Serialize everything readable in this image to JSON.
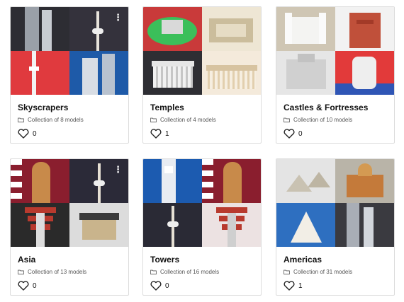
{
  "collections": [
    {
      "title": "Skyscrapers",
      "subtitle": "Collection of 8 models",
      "likes": "0",
      "colors": [
        "#2b2b30",
        "#3a3a45",
        "#e03a3e",
        "#1e5aa8"
      ]
    },
    {
      "title": "Temples",
      "subtitle": "Collection of 4 models",
      "likes": "1",
      "colors": [
        "#c93a3a",
        "#efe7d6",
        "#d6d6d6",
        "#f0e2c8"
      ]
    },
    {
      "title": "Castles & Fortresses",
      "subtitle": "Collection of 10 models",
      "likes": "0",
      "colors": [
        "#cfc6b4",
        "#f2f2f2",
        "#e8e8e8",
        "#e23a3a"
      ]
    },
    {
      "title": "Asia",
      "subtitle": "Collection of 13 models",
      "likes": "0",
      "colors": [
        "#8a1e2e",
        "#2a2a3a",
        "#2a2a2a",
        "#dcdcdc"
      ]
    },
    {
      "title": "Towers",
      "subtitle": "Collection of 16 models",
      "likes": "0",
      "colors": [
        "#1c5bb0",
        "#8a1e2e",
        "#2a2a35",
        "#e9e0e0"
      ]
    },
    {
      "title": "Americas",
      "subtitle": "Collection of 31 models",
      "likes": "1",
      "colors": [
        "#e4e4e4",
        "#b9b4a8",
        "#2e6fc0",
        "#3a3a40"
      ]
    }
  ],
  "icons": {
    "folder": "folder-icon",
    "heart": "heart-outline-icon",
    "menu": "kebab-menu-icon"
  }
}
